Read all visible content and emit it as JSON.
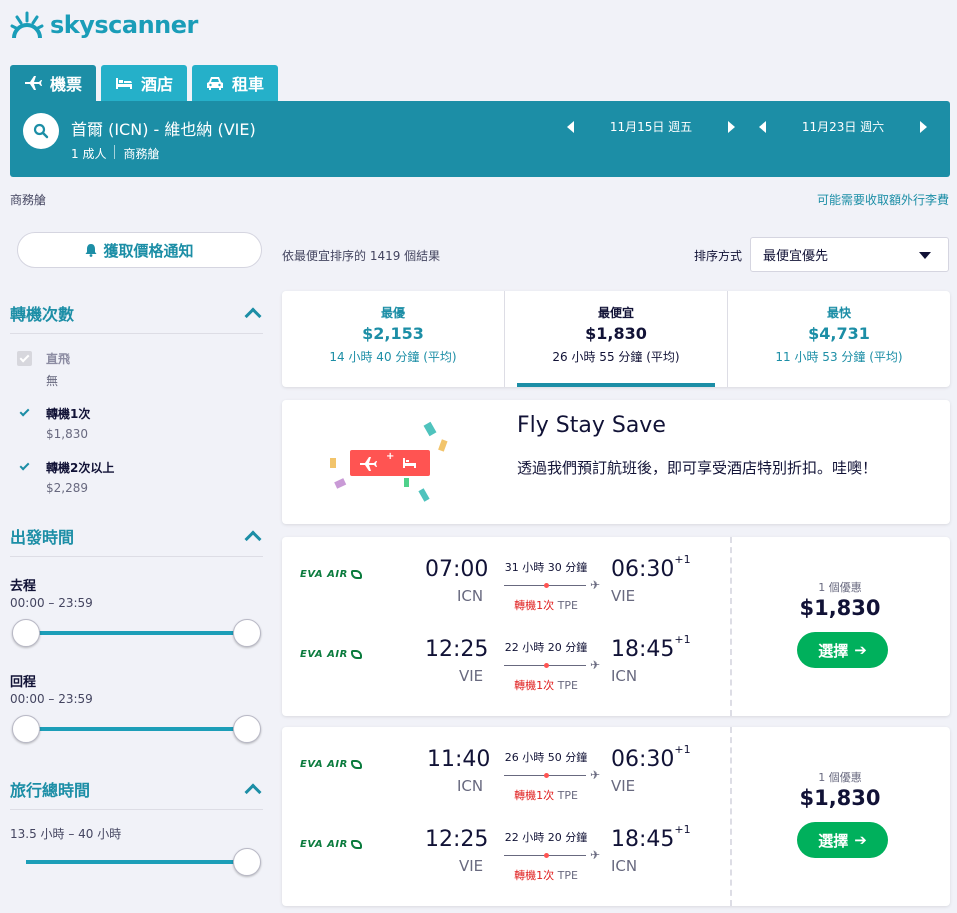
{
  "brand": {
    "name": "skyscanner",
    "color": "#1a9db8"
  },
  "tabs": [
    {
      "label": "機票",
      "icon": "plane-icon"
    },
    {
      "label": "酒店",
      "icon": "bed-icon"
    },
    {
      "label": "租車",
      "icon": "car-icon"
    }
  ],
  "search": {
    "route": "首爾 (ICN) - 維也納 (VIE)",
    "passengers": "1 成人",
    "cabin": "商務艙",
    "depart_date": "11月15日 週五",
    "return_date": "11月23日 週六"
  },
  "cabin_note": "商務艙",
  "baggage_link": "可能需要收取額外行李費",
  "sidebar": {
    "alert_label": "獲取價格通知",
    "stops": {
      "title": "轉機次數",
      "options": [
        {
          "label": "直飛",
          "sub": "無",
          "checked": true,
          "disabled": true
        },
        {
          "label": "轉機1次",
          "sub": "$1,830",
          "checked": true,
          "disabled": false
        },
        {
          "label": "轉機2次以上",
          "sub": "$2,289",
          "checked": true,
          "disabled": false
        }
      ]
    },
    "departure_times": {
      "title": "出發時間",
      "outbound_label": "去程",
      "outbound_range": "00:00 – 23:59",
      "return_label": "回程",
      "return_range": "00:00 – 23:59"
    },
    "duration": {
      "title": "旅行總時間",
      "range": "13.5 小時 – 40 小時"
    }
  },
  "results": {
    "count_text": "依最便宜排序的 1419 個結果",
    "sort_label": "排序方式",
    "sort_value": "最便宜優先"
  },
  "sort_tabs": [
    {
      "title": "最優",
      "price": "$2,153",
      "duration": "14 小時 40 分鐘 (平均)"
    },
    {
      "title": "最便宜",
      "price": "$1,830",
      "duration": "26 小時 55 分鐘 (平均)"
    },
    {
      "title": "最快",
      "price": "$4,731",
      "duration": "11 小時 53 分鐘 (平均)"
    }
  ],
  "promo": {
    "title": "Fly Stay Save",
    "body": "透過我們預訂航班後，即可享受酒店特別折扣。哇噢！",
    "badge_plus": "+"
  },
  "flights": [
    {
      "legs": [
        {
          "airline": "EVA AIR",
          "dep_time": "07:00",
          "dep_code": "ICN",
          "duration": "31 小時 30 分鐘",
          "stops_label": "轉機1次",
          "via": "TPE",
          "arr_time": "06:30",
          "arr_offset": "+1",
          "arr_code": "VIE"
        },
        {
          "airline": "EVA AIR",
          "dep_time": "12:25",
          "dep_code": "VIE",
          "duration": "22 小時 20 分鐘",
          "stops_label": "轉機1次",
          "via": "TPE",
          "arr_time": "18:45",
          "arr_offset": "+1",
          "arr_code": "ICN"
        }
      ],
      "deals": "1 個優惠",
      "price": "$1,830",
      "select_label": "選擇"
    },
    {
      "legs": [
        {
          "airline": "EVA AIR",
          "dep_time": "11:40",
          "dep_code": "ICN",
          "duration": "26 小時 50 分鐘",
          "stops_label": "轉機1次",
          "via": "TPE",
          "arr_time": "06:30",
          "arr_offset": "+1",
          "arr_code": "VIE"
        },
        {
          "airline": "EVA AIR",
          "dep_time": "12:25",
          "dep_code": "VIE",
          "duration": "22 小時 20 分鐘",
          "stops_label": "轉機1次",
          "via": "TPE",
          "arr_time": "18:45",
          "arr_offset": "+1",
          "arr_code": "ICN"
        }
      ],
      "deals": "1 個優惠",
      "price": "$1,830",
      "select_label": "選擇"
    }
  ]
}
